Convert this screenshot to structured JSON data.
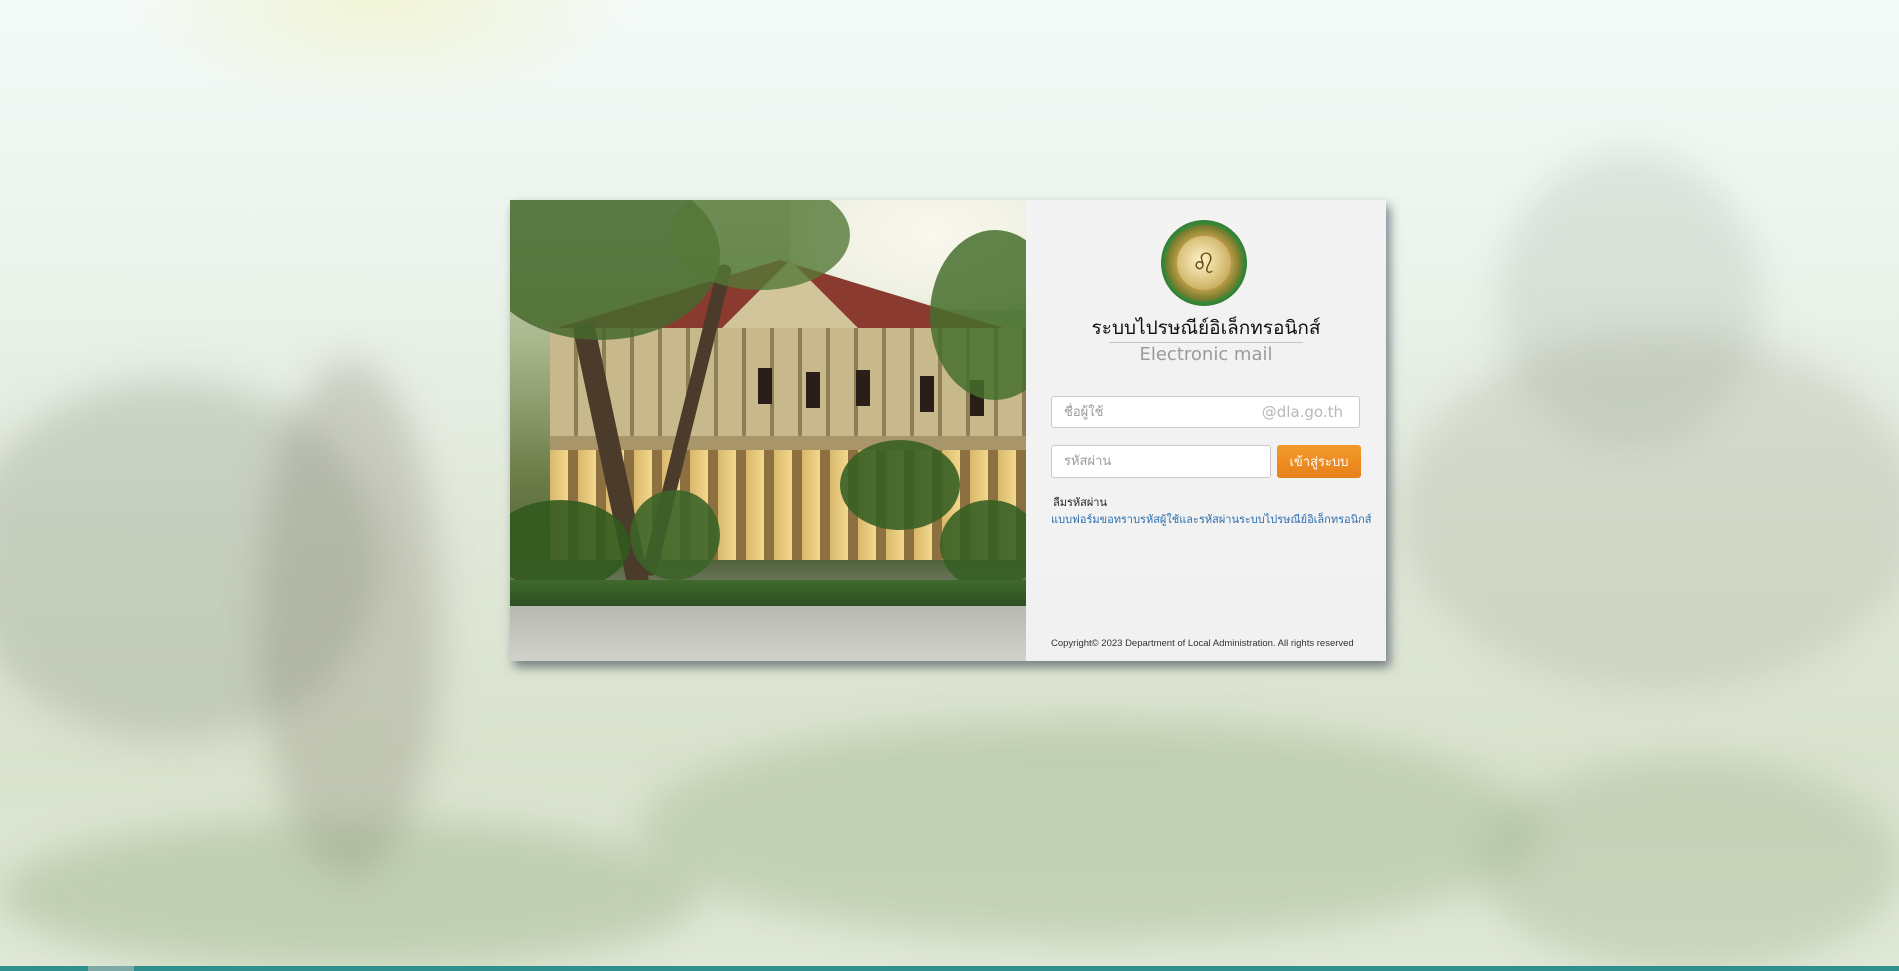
{
  "app": {
    "title_th": "ระบบไปรษณีย์อิเล็กทรอนิกส์",
    "title_en": "Electronic mail"
  },
  "form": {
    "username_placeholder": "ชื่อผู้ใช้",
    "domain_suffix": "@dla.go.th",
    "password_placeholder": "รหัสผ่าน",
    "login_button": "เข้าสู่ระบบ",
    "forgot_password_label": "ลืมรหัสผ่าน",
    "request_form_link": "แบบฟอร์มขอทราบรหัสผู้ใช้และรหัสผ่านระบบไปรษณีย์อิเล็กทรอนิกส์"
  },
  "footer": {
    "copyright": "Copyright© 2023 Department of Local Administration. All rights reserved"
  },
  "colors": {
    "accent": "#f0902a",
    "link": "#2a6fb0",
    "bottom_bar": "#2f8f8c"
  }
}
